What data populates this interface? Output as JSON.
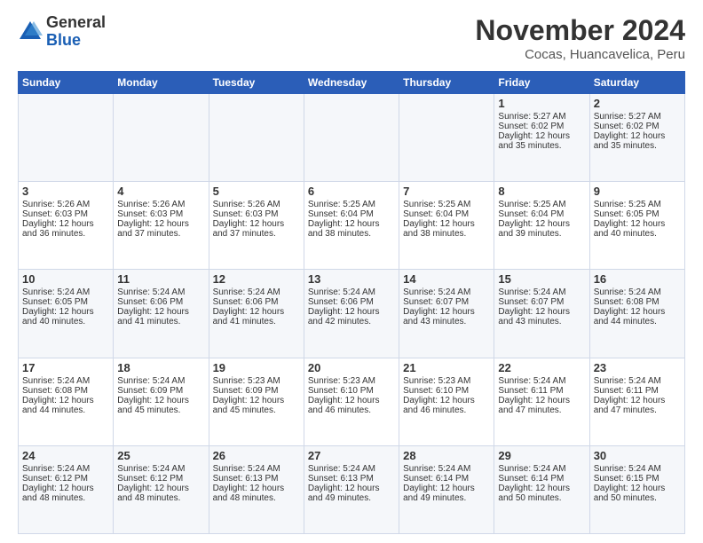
{
  "header": {
    "logo_general": "General",
    "logo_blue": "Blue",
    "month_title": "November 2024",
    "location": "Cocas, Huancavelica, Peru"
  },
  "weekdays": [
    "Sunday",
    "Monday",
    "Tuesday",
    "Wednesday",
    "Thursday",
    "Friday",
    "Saturday"
  ],
  "weeks": [
    [
      {
        "day": "",
        "content": ""
      },
      {
        "day": "",
        "content": ""
      },
      {
        "day": "",
        "content": ""
      },
      {
        "day": "",
        "content": ""
      },
      {
        "day": "",
        "content": ""
      },
      {
        "day": "1",
        "content": "Sunrise: 5:27 AM\nSunset: 6:02 PM\nDaylight: 12 hours and 35 minutes."
      },
      {
        "day": "2",
        "content": "Sunrise: 5:27 AM\nSunset: 6:02 PM\nDaylight: 12 hours and 35 minutes."
      }
    ],
    [
      {
        "day": "3",
        "content": "Sunrise: 5:26 AM\nSunset: 6:03 PM\nDaylight: 12 hours and 36 minutes."
      },
      {
        "day": "4",
        "content": "Sunrise: 5:26 AM\nSunset: 6:03 PM\nDaylight: 12 hours and 37 minutes."
      },
      {
        "day": "5",
        "content": "Sunrise: 5:26 AM\nSunset: 6:03 PM\nDaylight: 12 hours and 37 minutes."
      },
      {
        "day": "6",
        "content": "Sunrise: 5:25 AM\nSunset: 6:04 PM\nDaylight: 12 hours and 38 minutes."
      },
      {
        "day": "7",
        "content": "Sunrise: 5:25 AM\nSunset: 6:04 PM\nDaylight: 12 hours and 38 minutes."
      },
      {
        "day": "8",
        "content": "Sunrise: 5:25 AM\nSunset: 6:04 PM\nDaylight: 12 hours and 39 minutes."
      },
      {
        "day": "9",
        "content": "Sunrise: 5:25 AM\nSunset: 6:05 PM\nDaylight: 12 hours and 40 minutes."
      }
    ],
    [
      {
        "day": "10",
        "content": "Sunrise: 5:24 AM\nSunset: 6:05 PM\nDaylight: 12 hours and 40 minutes."
      },
      {
        "day": "11",
        "content": "Sunrise: 5:24 AM\nSunset: 6:06 PM\nDaylight: 12 hours and 41 minutes."
      },
      {
        "day": "12",
        "content": "Sunrise: 5:24 AM\nSunset: 6:06 PM\nDaylight: 12 hours and 41 minutes."
      },
      {
        "day": "13",
        "content": "Sunrise: 5:24 AM\nSunset: 6:06 PM\nDaylight: 12 hours and 42 minutes."
      },
      {
        "day": "14",
        "content": "Sunrise: 5:24 AM\nSunset: 6:07 PM\nDaylight: 12 hours and 43 minutes."
      },
      {
        "day": "15",
        "content": "Sunrise: 5:24 AM\nSunset: 6:07 PM\nDaylight: 12 hours and 43 minutes."
      },
      {
        "day": "16",
        "content": "Sunrise: 5:24 AM\nSunset: 6:08 PM\nDaylight: 12 hours and 44 minutes."
      }
    ],
    [
      {
        "day": "17",
        "content": "Sunrise: 5:24 AM\nSunset: 6:08 PM\nDaylight: 12 hours and 44 minutes."
      },
      {
        "day": "18",
        "content": "Sunrise: 5:24 AM\nSunset: 6:09 PM\nDaylight: 12 hours and 45 minutes."
      },
      {
        "day": "19",
        "content": "Sunrise: 5:23 AM\nSunset: 6:09 PM\nDaylight: 12 hours and 45 minutes."
      },
      {
        "day": "20",
        "content": "Sunrise: 5:23 AM\nSunset: 6:10 PM\nDaylight: 12 hours and 46 minutes."
      },
      {
        "day": "21",
        "content": "Sunrise: 5:23 AM\nSunset: 6:10 PM\nDaylight: 12 hours and 46 minutes."
      },
      {
        "day": "22",
        "content": "Sunrise: 5:24 AM\nSunset: 6:11 PM\nDaylight: 12 hours and 47 minutes."
      },
      {
        "day": "23",
        "content": "Sunrise: 5:24 AM\nSunset: 6:11 PM\nDaylight: 12 hours and 47 minutes."
      }
    ],
    [
      {
        "day": "24",
        "content": "Sunrise: 5:24 AM\nSunset: 6:12 PM\nDaylight: 12 hours and 48 minutes."
      },
      {
        "day": "25",
        "content": "Sunrise: 5:24 AM\nSunset: 6:12 PM\nDaylight: 12 hours and 48 minutes."
      },
      {
        "day": "26",
        "content": "Sunrise: 5:24 AM\nSunset: 6:13 PM\nDaylight: 12 hours and 48 minutes."
      },
      {
        "day": "27",
        "content": "Sunrise: 5:24 AM\nSunset: 6:13 PM\nDaylight: 12 hours and 49 minutes."
      },
      {
        "day": "28",
        "content": "Sunrise: 5:24 AM\nSunset: 6:14 PM\nDaylight: 12 hours and 49 minutes."
      },
      {
        "day": "29",
        "content": "Sunrise: 5:24 AM\nSunset: 6:14 PM\nDaylight: 12 hours and 50 minutes."
      },
      {
        "day": "30",
        "content": "Sunrise: 5:24 AM\nSunset: 6:15 PM\nDaylight: 12 hours and 50 minutes."
      }
    ]
  ]
}
